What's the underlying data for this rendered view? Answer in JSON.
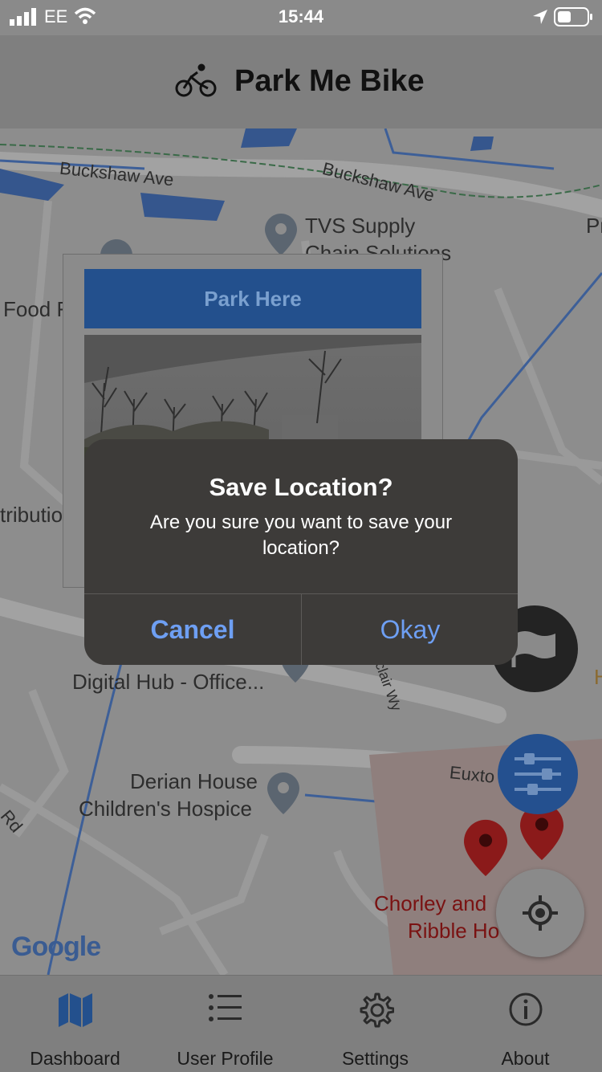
{
  "status_bar": {
    "carrier": "EE",
    "time": "15:44"
  },
  "header": {
    "title": "Park Me Bike",
    "icon": "bicycle-icon"
  },
  "map": {
    "road_labels": [
      "Buckshaw Ave",
      "Buckshaw Ave",
      "Euxto",
      "Rd",
      "Sinclair Wy"
    ],
    "places": {
      "tvs_line1": "TVS Supply",
      "tvs_line2": "Chain Solutions",
      "food": "Food F",
      "distribution": "tributio",
      "digital_hub": "Digital Hub - Office...",
      "derian_line1": "Derian House",
      "derian_line2": "Children's Hospice",
      "chorley_line1": "Chorley and",
      "chorley_line2": "Ribble Ho",
      "pr": "Pr",
      "h": "H"
    },
    "attribution": "Google"
  },
  "info_window": {
    "park_here_label": "Park Here"
  },
  "alert": {
    "title": "Save Location?",
    "message": "Are you sure you want to save your location?",
    "cancel_label": "Cancel",
    "okay_label": "Okay"
  },
  "fabs": {
    "flag": "flag-icon",
    "filter": "sliders-icon",
    "locate": "crosshair-icon"
  },
  "colors": {
    "primary_blue": "#2d6cc0",
    "alert_button": "#6e9ff3",
    "overlay_bg": "#8a8a8a"
  },
  "tabs": [
    {
      "label": "Dashboard",
      "icon": "map-icon",
      "active": true
    },
    {
      "label": "User Profile",
      "icon": "list-icon",
      "active": false
    },
    {
      "label": "Settings",
      "icon": "gear-icon",
      "active": false
    },
    {
      "label": "About",
      "icon": "info-icon",
      "active": false
    }
  ]
}
